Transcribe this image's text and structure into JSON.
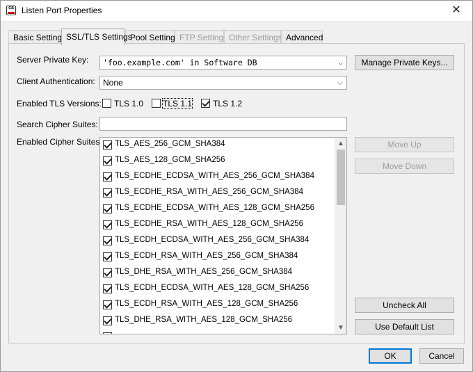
{
  "window": {
    "title": "Listen Port Properties",
    "icon": "ca-logo-icon",
    "close_glyph": "✕"
  },
  "tabs": [
    {
      "label": "Basic Settings",
      "active": false,
      "enabled": true
    },
    {
      "label": "SSL/TLS Settings",
      "active": true,
      "enabled": true
    },
    {
      "label": "Pool Settings",
      "active": false,
      "enabled": true
    },
    {
      "label": "FTP Settings",
      "active": false,
      "enabled": false
    },
    {
      "label": "Other Settings",
      "active": false,
      "enabled": false
    },
    {
      "label": "Advanced",
      "active": false,
      "enabled": true
    }
  ],
  "form": {
    "private_key_label": "Server Private Key:",
    "private_key_value": "'foo.example.com' in Software DB",
    "manage_keys_button": "Manage Private Keys...",
    "client_auth_label": "Client Authentication:",
    "client_auth_value": "None",
    "tls_versions_label": "Enabled TLS Versions:",
    "tls_versions": [
      {
        "label": "TLS 1.0",
        "checked": false
      },
      {
        "label": "TLS 1.1",
        "checked": false
      },
      {
        "label": "TLS 1.2",
        "checked": true
      }
    ],
    "search_label": "Search Cipher Suites:",
    "search_value": "",
    "cipher_label": "Enabled Cipher Suites:",
    "cipher_suites": [
      {
        "name": "TLS_AES_256_GCM_SHA384",
        "checked": true
      },
      {
        "name": "TLS_AES_128_GCM_SHA256",
        "checked": true
      },
      {
        "name": "TLS_ECDHE_ECDSA_WITH_AES_256_GCM_SHA384",
        "checked": true
      },
      {
        "name": "TLS_ECDHE_RSA_WITH_AES_256_GCM_SHA384",
        "checked": true
      },
      {
        "name": "TLS_ECDHE_ECDSA_WITH_AES_128_GCM_SHA256",
        "checked": true
      },
      {
        "name": "TLS_ECDHE_RSA_WITH_AES_128_GCM_SHA256",
        "checked": true
      },
      {
        "name": "TLS_ECDH_ECDSA_WITH_AES_256_GCM_SHA384",
        "checked": true
      },
      {
        "name": "TLS_ECDH_RSA_WITH_AES_256_GCM_SHA384",
        "checked": true
      },
      {
        "name": "TLS_DHE_RSA_WITH_AES_256_GCM_SHA384",
        "checked": true
      },
      {
        "name": "TLS_ECDH_ECDSA_WITH_AES_128_GCM_SHA256",
        "checked": true
      },
      {
        "name": "TLS_ECDH_RSA_WITH_AES_128_GCM_SHA256",
        "checked": true
      },
      {
        "name": "TLS_DHE_RSA_WITH_AES_128_GCM_SHA256",
        "checked": true
      }
    ],
    "move_up_button": "Move Up",
    "move_down_button": "Move Down",
    "uncheck_all_button": "Uncheck All",
    "default_list_button": "Use Default List",
    "dropdown_glyph": "⌵",
    "scroll_up_glyph": "▲",
    "scroll_down_glyph": "▼"
  },
  "footer": {
    "ok_button": "OK",
    "cancel_button": "Cancel"
  },
  "colors": {
    "focus_border": "#0078d7",
    "disabled_text": "#9a9a9a"
  }
}
